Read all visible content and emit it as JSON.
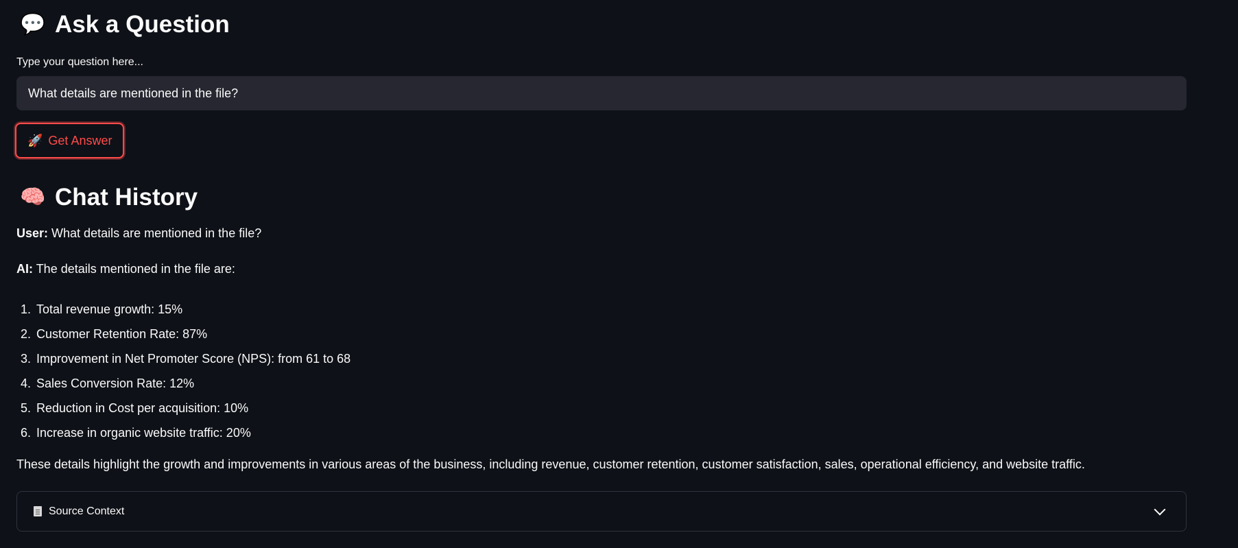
{
  "ask": {
    "icon": "speech-bubble-icon",
    "heading": "Ask a Question",
    "label": "Type your question here...",
    "value": "What details are mentioned in the file?",
    "button_icon": "rocket-icon",
    "button_label": "Get Answer",
    "accent_color": "#ff4b4b"
  },
  "chat": {
    "icon": "brain-icon",
    "heading": "Chat History",
    "user_prefix": "User:",
    "user_text": "What details are mentioned in the file?",
    "ai_prefix": "AI:",
    "ai_intro": "The details mentioned in the file are:",
    "items": [
      {
        "num": "1.",
        "text": "Total revenue growth: 15%"
      },
      {
        "num": "2.",
        "text": "Customer Retention Rate: 87%"
      },
      {
        "num": "3.",
        "text": "Improvement in Net Promoter Score (NPS): from 61 to 68"
      },
      {
        "num": "4.",
        "text": "Sales Conversion Rate: 12%"
      },
      {
        "num": "5.",
        "text": "Reduction in Cost per acquisition: 10%"
      },
      {
        "num": "6.",
        "text": "Increase in organic website traffic: 20%"
      }
    ],
    "summary": "These details highlight the growth and improvements in various areas of the business, including revenue, customer retention, customer satisfaction, sales, operational efficiency, and website traffic."
  },
  "source": {
    "icon": "document-icon",
    "label": "Source Context",
    "toggle_icon": "chevron-down-icon"
  }
}
